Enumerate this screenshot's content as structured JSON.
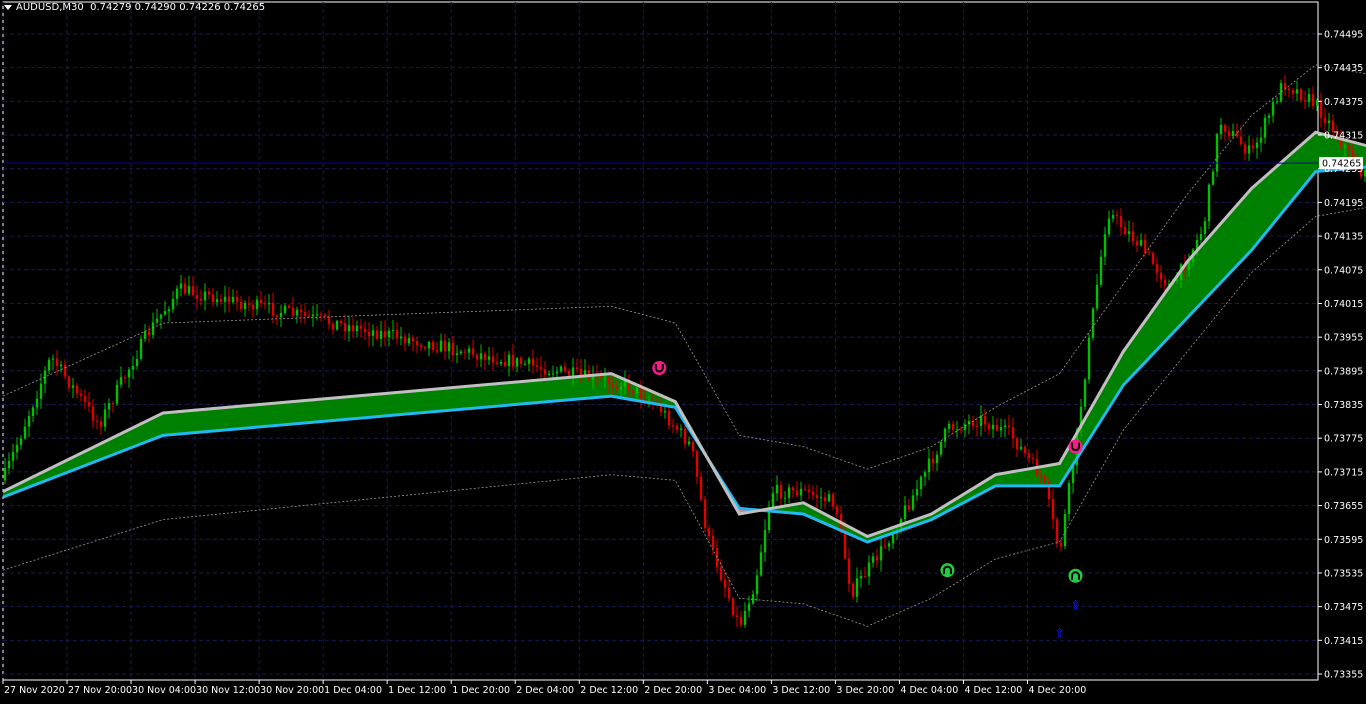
{
  "header": {
    "symbol": "AUDUSD",
    "timeframe": "M30",
    "ohlc": "0.74279 0.74290 0.74226 0.74265"
  },
  "colors": {
    "background": "#000000",
    "grid": "#1a1a50",
    "axis": "#ffffff",
    "bull": "#00c000",
    "bear": "#e00000",
    "cloud_up": "#008000",
    "cloud_down": "#e07a90",
    "ma_fast": "#c0c0c0",
    "ma_slow": "#22b8f0",
    "envelope": "#9a9a9a",
    "bid_line": "#0000b0",
    "arrow_buy": "#22cc44",
    "arrow_sell": "#ff1a8c",
    "arrow_small": "#1a1aff"
  },
  "price_axis": {
    "labels": [
      "0.74495",
      "0.74435",
      "0.74375",
      "0.74315",
      "0.74255",
      "0.74195",
      "0.74135",
      "0.74075",
      "0.74015",
      "0.73955",
      "0.73895",
      "0.73835",
      "0.73775",
      "0.73715",
      "0.73655",
      "0.73595",
      "0.73535",
      "0.73475",
      "0.73415",
      "0.73355"
    ],
    "current_price": "0.74265"
  },
  "time_axis": {
    "labels": [
      "27 Nov 2020",
      "27 Nov 20:00",
      "30 Nov 04:00",
      "30 Nov 12:00",
      "30 Nov 20:00",
      "1 Dec 04:00",
      "1 Dec 12:00",
      "1 Dec 20:00",
      "2 Dec 04:00",
      "2 Dec 12:00",
      "2 Dec 20:00",
      "3 Dec 04:00",
      "3 Dec 12:00",
      "3 Dec 20:00",
      "4 Dec 04:00",
      "4 Dec 12:00",
      "4 Dec 20:00"
    ]
  },
  "chart_data": {
    "type": "candlestick",
    "symbol": "AUDUSD",
    "timeframe": "M30",
    "ylim": [
      0.7335,
      0.7452
    ],
    "grid": true,
    "price_path": [
      [
        "27 Nov 2020",
        0.737
      ],
      [
        "27 Nov 06:00",
        0.7392
      ],
      [
        "27 Nov 12:00",
        0.738
      ],
      [
        "27 Nov 18:00",
        0.7396
      ],
      [
        "27 Nov 22:00",
        0.7404
      ],
      [
        "30 Nov 02:00",
        0.7388
      ],
      [
        "30 Nov 06:00",
        0.7387
      ],
      [
        "30 Nov 10:00",
        0.7383
      ],
      [
        "30 Nov 14:00",
        0.7376
      ],
      [
        "30 Nov 16:00",
        0.736
      ],
      [
        "30 Nov 20:00",
        0.7344
      ],
      [
        "30 Nov 22:00",
        0.7352
      ],
      [
        "1 Dec 00:00",
        0.7368
      ],
      [
        "1 Dec 04:00",
        0.7368
      ],
      [
        "1 Dec 08:00",
        0.7366
      ],
      [
        "1 Dec 10:00",
        0.735
      ],
      [
        "1 Dec 14:00",
        0.7358
      ],
      [
        "1 Dec 18:00",
        0.7368
      ],
      [
        "1 Dec 22:00",
        0.7379
      ],
      [
        "2 Dec 02:00",
        0.7381
      ],
      [
        "2 Dec 06:00",
        0.7378
      ],
      [
        "2 Dec 10:00",
        0.737
      ],
      [
        "2 Dec 12:00",
        0.7357
      ],
      [
        "2 Dec 14:00",
        0.7376
      ],
      [
        "2 Dec 16:00",
        0.7398
      ],
      [
        "2 Dec 18:00",
        0.7418
      ],
      [
        "2 Dec 22:00",
        0.7412
      ],
      [
        "3 Dec 02:00",
        0.7404
      ],
      [
        "3 Dec 06:00",
        0.7415
      ],
      [
        "3 Dec 08:00",
        0.7434
      ],
      [
        "3 Dec 12:00",
        0.7428
      ],
      [
        "3 Dec 16:00",
        0.7441
      ],
      [
        "3 Dec 20:00",
        0.7437
      ],
      [
        "3 Dec 22:00",
        0.7433
      ],
      [
        "4 Dec 02:00",
        0.7424
      ],
      [
        "4 Dec 06:00",
        0.7426
      ],
      [
        "4 Dec 10:00",
        0.7417
      ],
      [
        "4 Dec 14:00",
        0.7426
      ],
      [
        "4 Dec 18:00",
        0.7438
      ],
      [
        "4 Dec 21:00",
        0.7427
      ]
    ],
    "ma_fast": [
      [
        "27 Nov 2020",
        0.7368
      ],
      [
        "27 Nov 20:00",
        0.7382
      ],
      [
        "30 Nov 04:00",
        0.7389
      ],
      [
        "30 Nov 12:00",
        0.7384
      ],
      [
        "30 Nov 20:00",
        0.7364
      ],
      [
        "1 Dec 04:00",
        0.7366
      ],
      [
        "1 Dec 12:00",
        0.736
      ],
      [
        "1 Dec 20:00",
        0.7364
      ],
      [
        "2 Dec 04:00",
        0.7371
      ],
      [
        "2 Dec 12:00",
        0.7373
      ],
      [
        "2 Dec 20:00",
        0.7393
      ],
      [
        "3 Dec 04:00",
        0.7409
      ],
      [
        "3 Dec 12:00",
        0.7422
      ],
      [
        "3 Dec 20:00",
        0.7432
      ],
      [
        "4 Dec 04:00",
        0.7429
      ],
      [
        "4 Dec 12:00",
        0.7428
      ],
      [
        "4 Dec 21:00",
        0.7431
      ]
    ],
    "ma_slow": [
      [
        "27 Nov 2020",
        0.7367
      ],
      [
        "27 Nov 20:00",
        0.7378
      ],
      [
        "30 Nov 04:00",
        0.7385
      ],
      [
        "30 Nov 12:00",
        0.7383
      ],
      [
        "30 Nov 20:00",
        0.7365
      ],
      [
        "1 Dec 04:00",
        0.7364
      ],
      [
        "1 Dec 12:00",
        0.7359
      ],
      [
        "1 Dec 20:00",
        0.7363
      ],
      [
        "2 Dec 04:00",
        0.7369
      ],
      [
        "2 Dec 12:00",
        0.7369
      ],
      [
        "2 Dec 20:00",
        0.7387
      ],
      [
        "3 Dec 04:00",
        0.7399
      ],
      [
        "3 Dec 12:00",
        0.7411
      ],
      [
        "3 Dec 20:00",
        0.7425
      ],
      [
        "4 Dec 04:00",
        0.7426
      ],
      [
        "4 Dec 12:00",
        0.7426
      ],
      [
        "4 Dec 21:00",
        0.7429
      ]
    ],
    "envelope_upper": [
      [
        "27 Nov 2020",
        0.7385
      ],
      [
        "27 Nov 20:00",
        0.7398
      ],
      [
        "30 Nov 04:00",
        0.7401
      ],
      [
        "30 Nov 12:00",
        0.7398
      ],
      [
        "30 Nov 20:00",
        0.7378
      ],
      [
        "1 Dec 04:00",
        0.7376
      ],
      [
        "1 Dec 12:00",
        0.7372
      ],
      [
        "1 Dec 20:00",
        0.7376
      ],
      [
        "2 Dec 04:00",
        0.7383
      ],
      [
        "2 Dec 12:00",
        0.7389
      ],
      [
        "2 Dec 20:00",
        0.7405
      ],
      [
        "3 Dec 04:00",
        0.7421
      ],
      [
        "3 Dec 12:00",
        0.7435
      ],
      [
        "3 Dec 20:00",
        0.7444
      ],
      [
        "4 Dec 04:00",
        0.7442
      ],
      [
        "4 Dec 12:00",
        0.7441
      ],
      [
        "4 Dec 21:00",
        0.7442
      ]
    ],
    "envelope_lower": [
      [
        "27 Nov 2020",
        0.7354
      ],
      [
        "27 Nov 20:00",
        0.7363
      ],
      [
        "30 Nov 04:00",
        0.7371
      ],
      [
        "30 Nov 12:00",
        0.737
      ],
      [
        "30 Nov 20:00",
        0.7349
      ],
      [
        "1 Dec 04:00",
        0.7348
      ],
      [
        "1 Dec 12:00",
        0.7344
      ],
      [
        "1 Dec 20:00",
        0.7349
      ],
      [
        "2 Dec 04:00",
        0.7356
      ],
      [
        "2 Dec 12:00",
        0.7359
      ],
      [
        "2 Dec 20:00",
        0.7379
      ],
      [
        "3 Dec 04:00",
        0.7393
      ],
      [
        "3 Dec 12:00",
        0.7407
      ],
      [
        "3 Dec 20:00",
        0.7417
      ],
      [
        "4 Dec 04:00",
        0.7419
      ],
      [
        "4 Dec 12:00",
        0.7414
      ],
      [
        "4 Dec 21:00",
        0.7418
      ]
    ],
    "signals": [
      {
        "time": "30 Nov 10:00",
        "price": 0.739,
        "type": "sell"
      },
      {
        "time": "1 Dec 22:00",
        "price": 0.7354,
        "type": "buy"
      },
      {
        "time": "2 Dec 14:00",
        "price": 0.7376,
        "type": "sell"
      },
      {
        "time": "2 Dec 14:00",
        "price": 0.7353,
        "type": "buy"
      },
      {
        "time": "4 Dec 08:00",
        "price": 0.7431,
        "type": "sell"
      },
      {
        "time": "4 Dec 14:00",
        "price": 0.7419,
        "type": "buy"
      },
      {
        "time": "2 Dec 14:00",
        "price": 0.7348,
        "type": "small-up"
      },
      {
        "time": "2 Dec 12:00",
        "price": 0.7343,
        "type": "small-up"
      }
    ]
  }
}
